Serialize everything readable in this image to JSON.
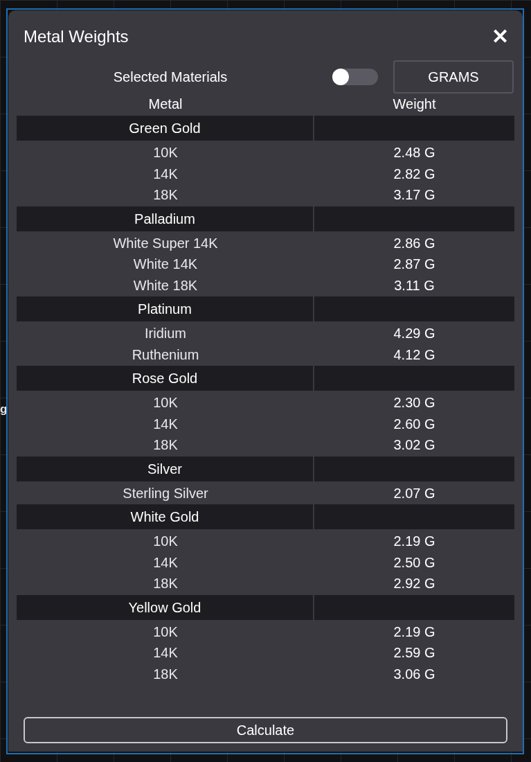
{
  "background_text": "g",
  "dialog": {
    "title": "Metal Weights",
    "close_icon": "✕"
  },
  "controls": {
    "label": "Selected Materials",
    "toggle": {
      "on": false
    },
    "unit_button": "GRAMS"
  },
  "table": {
    "columns": [
      "Metal",
      "Weight"
    ],
    "groups": [
      {
        "name": "Green Gold",
        "rows": [
          {
            "metal": "10K",
            "weight": "2.48 G"
          },
          {
            "metal": "14K",
            "weight": "2.82 G"
          },
          {
            "metal": "18K",
            "weight": "3.17 G"
          }
        ]
      },
      {
        "name": "Palladium",
        "rows": [
          {
            "metal": "White Super 14K",
            "weight": "2.86 G"
          },
          {
            "metal": "White 14K",
            "weight": "2.87 G"
          },
          {
            "metal": "White 18K",
            "weight": "3.11 G"
          }
        ]
      },
      {
        "name": "Platinum",
        "rows": [
          {
            "metal": "Iridium",
            "weight": "4.29 G"
          },
          {
            "metal": "Ruthenium",
            "weight": "4.12 G"
          }
        ]
      },
      {
        "name": "Rose Gold",
        "rows": [
          {
            "metal": "10K",
            "weight": "2.30 G"
          },
          {
            "metal": "14K",
            "weight": "2.60 G"
          },
          {
            "metal": "18K",
            "weight": "3.02 G"
          }
        ]
      },
      {
        "name": "Silver",
        "rows": [
          {
            "metal": "Sterling Silver",
            "weight": "2.07 G"
          }
        ]
      },
      {
        "name": "White Gold",
        "rows": [
          {
            "metal": "10K",
            "weight": "2.19 G"
          },
          {
            "metal": "14K",
            "weight": "2.50 G"
          },
          {
            "metal": "18K",
            "weight": "2.92 G"
          }
        ]
      },
      {
        "name": "Yellow Gold",
        "rows": [
          {
            "metal": "10K",
            "weight": "2.19 G"
          },
          {
            "metal": "14K",
            "weight": "2.59 G"
          },
          {
            "metal": "18K",
            "weight": "3.06 G"
          }
        ]
      }
    ]
  },
  "calculate_button": "Calculate"
}
